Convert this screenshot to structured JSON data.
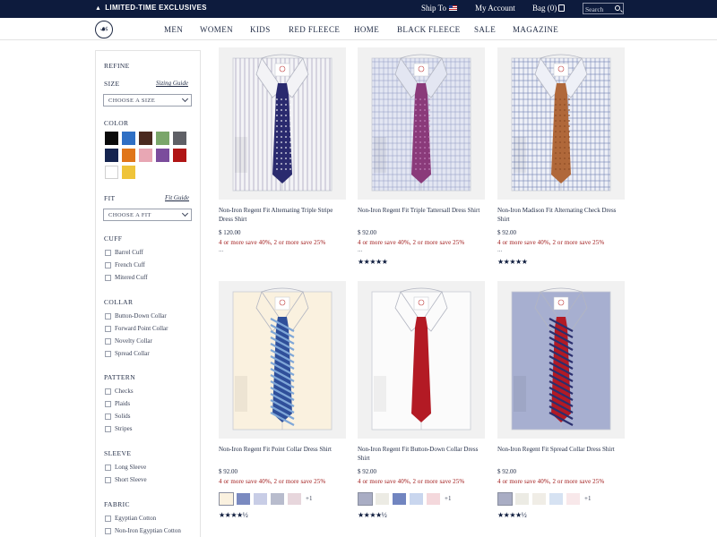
{
  "topbar": {
    "promo": "LIMITED-TIME EXCLUSIVES",
    "ship_to": "Ship To",
    "my_account": "My Account",
    "bag": "Bag (0)",
    "search_placeholder": "Search",
    "flag_icon": "us-flag-icon",
    "bag_icon": "shopping-bag-icon",
    "search_icon": "search-icon"
  },
  "nav": {
    "logo_icon": "golden-fleece-logo",
    "items": [
      "MEN",
      "WOMEN",
      "KIDS",
      "RED FLEECE",
      "HOME",
      "BLACK FLEECE",
      "SALE",
      "MAGAZINE"
    ]
  },
  "sidebar": {
    "refine": "REFINE",
    "size": {
      "heading": "SIZE",
      "guide": "Sizing Guide",
      "select": "CHOOSE A SIZE"
    },
    "color": {
      "heading": "COLOR",
      "swatches": [
        "#0a0a0a",
        "#2f6fc4",
        "#4a2a1f",
        "#7aa66a",
        "#5f6066",
        "#15244f",
        "#e0761a",
        "#e8a7b4",
        "#7b4c9c",
        "#b01515",
        "#ffffff",
        "#efc43a"
      ]
    },
    "fit": {
      "heading": "FIT",
      "guide": "Fit Guide",
      "select": "CHOOSE A FIT"
    },
    "cuff": {
      "heading": "CUFF",
      "options": [
        "Barrel Cuff",
        "French Cuff",
        "Mitered Cuff"
      ]
    },
    "collar": {
      "heading": "COLLAR",
      "options": [
        "Button-Down Collar",
        "Forward Point Collar",
        "Novelty Collar",
        "Spread Collar"
      ]
    },
    "pattern": {
      "heading": "PATTERN",
      "options": [
        "Checks",
        "Plaids",
        "Solids",
        "Stripes"
      ]
    },
    "sleeve": {
      "heading": "SLEEVE",
      "options": [
        "Long Sleeve",
        "Short Sleeve"
      ]
    },
    "fabric": {
      "heading": "FABRIC",
      "options": [
        "Egyptian Cotton",
        "Non-Iron Egyptian Cotton"
      ]
    }
  },
  "products": [
    {
      "name": "Non-Iron Regent Fit Alternating Triple Stripe Dress Shirt",
      "price": "$ 120.00",
      "promo": "4 or more save 40%, 2 or more save 25%",
      "ellipsis": "...",
      "stars": "",
      "shirt": "#f3f3f6",
      "pattern": "stripe",
      "pattern_color": "#8a87a8",
      "tie": "#2a2a6e",
      "tie_stripe": "#ffffff",
      "tie_pattern": "dots",
      "swatches": [],
      "more": ""
    },
    {
      "name": "Non-Iron Regent Fit Triple Tattersall Dress Shirt",
      "price": "$ 92.00",
      "promo": "4 or more save 40%, 2 or more save 25%",
      "ellipsis": "...",
      "stars": "★★★★★",
      "rating": 5,
      "shirt": "#e3e6f2",
      "pattern": "check",
      "pattern_color": "#9aa2c8",
      "tie": "#8a3a7a",
      "tie_stripe": "#c58ac0",
      "tie_pattern": "dots",
      "swatches": [],
      "more": ""
    },
    {
      "name": "Non-Iron Madison Fit Alternating Check Dress Shirt",
      "price": "$ 92.00",
      "promo": "4 or more save 40%, 2 or more save 25%",
      "ellipsis": "...",
      "stars": "★★★★★",
      "rating": 5,
      "shirt": "#eef0f7",
      "pattern": "check",
      "pattern_color": "#6f7fb0",
      "tie": "#b0683a",
      "tie_stripe": "#8a4a25",
      "tie_pattern": "dots",
      "swatches": [],
      "more": ""
    },
    {
      "name": "Non-Iron Regent Fit Point Collar Dress Shirt",
      "price": "$ 92.00",
      "promo": "4 or more save 40%, 2 or more save 25%",
      "ellipsis": "",
      "stars": "★★★★½",
      "rating": 4.5,
      "shirt": "#faf1df",
      "pattern": "solid",
      "pattern_color": "#faf1df",
      "tie": "#2f4f9a",
      "tie_stripe": "#7fa7d8",
      "tie_pattern": "stripe",
      "swatches": [
        "#faf1df",
        "#7a8ac0",
        "#c8cde6",
        "#b8bccd",
        "#e7d6dc"
      ],
      "more": "+1"
    },
    {
      "name": "Non-Iron Regent Fit Button-Down Collar Dress Shirt",
      "price": "$ 92.00",
      "promo": "4 or more save 40%, 2 or more save 25%",
      "ellipsis": "",
      "stars": "★★★★½",
      "rating": 4.5,
      "shirt": "#fbfbfb",
      "pattern": "solid",
      "pattern_color": "#fbfbfb",
      "tie": "#b31a24",
      "tie_stripe": "#8c1219",
      "tie_pattern": "solid",
      "swatches": [
        "#a9adc4",
        "#ecebe4",
        "#7185c0",
        "#c9d6ee",
        "#f4d8dc"
      ],
      "more": "+1"
    },
    {
      "name": "Non-Iron Regent Fit Spread Collar Dress Shirt",
      "price": "$ 92.00",
      "promo": "4 or more save 40%, 2 or more save 25%",
      "ellipsis": "",
      "stars": "★★★★½",
      "rating": 4.5,
      "shirt": "#a7afd0",
      "pattern": "solid",
      "pattern_color": "#a7afd0",
      "tie": "#b31a24",
      "tie_stripe": "#2b2f6e",
      "tie_pattern": "stripe",
      "swatches": [
        "#a9adc4",
        "#ecebe4",
        "#f0ede6",
        "#d6e2f2",
        "#f8e8ea"
      ],
      "more": "+1"
    }
  ]
}
